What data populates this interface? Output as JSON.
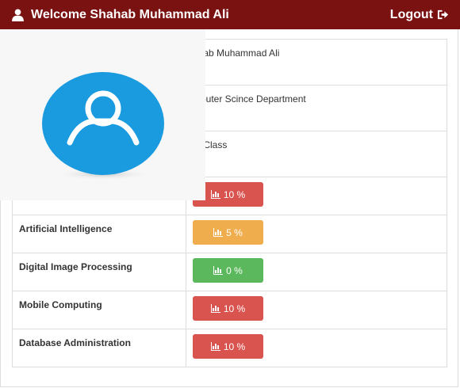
{
  "header": {
    "welcome_text": "Welcome Shahab Muhammad Ali",
    "logout_label": "Logout",
    "user_icon": "user-icon",
    "logout_icon": "sign-out-icon",
    "bar_color": "#7a1212"
  },
  "profile": {
    "name": "ahab Muhammad Ali",
    "department": "mputer Scince Department",
    "class": "th Class",
    "avatar_icon": "user-avatar-icon",
    "avatar_color": "#1a9bdf"
  },
  "subjects": [
    {
      "name": "",
      "percent": "10 %",
      "color": "#d9534f"
    },
    {
      "name": "Artificial Intelligence",
      "percent": "5 %",
      "color": "#f0ad4e"
    },
    {
      "name": "Digital Image Processing",
      "percent": "0 %",
      "color": "#5cb85c"
    },
    {
      "name": "Mobile Computing",
      "percent": "10 %",
      "color": "#d9534f"
    },
    {
      "name": "Database Administration",
      "percent": "10 %",
      "color": "#d9534f"
    }
  ],
  "badge_icon": "bar-chart-icon"
}
